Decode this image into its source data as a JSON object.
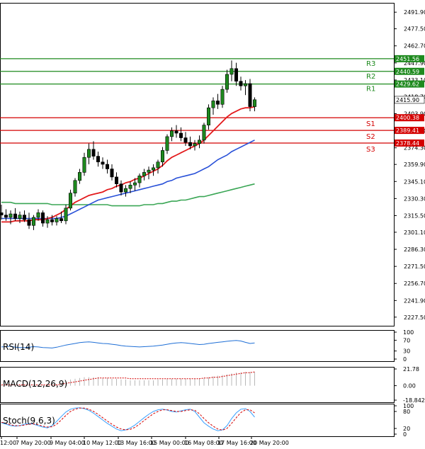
{
  "chart_data": {
    "type": "candlestick",
    "main": {
      "ylim": [
        2220,
        2500
      ],
      "y_ticks": [
        "2491.90",
        "2477.50",
        "2462.70",
        "2447.90",
        "2433.10",
        "2418.70",
        "2403.90",
        "2389.10",
        "2374.30",
        "2359.90",
        "2345.10",
        "2330.30",
        "2315.50",
        "2301.10",
        "2286.30",
        "2271.50",
        "2256.70",
        "2241.90",
        "2227.50"
      ],
      "current_price": "2415.90",
      "levels": [
        {
          "name": "R3",
          "value": 2451.56,
          "label": "2451.56",
          "role": "resistance"
        },
        {
          "name": "R2",
          "value": 2440.59,
          "label": "2440.59",
          "role": "resistance"
        },
        {
          "name": "R1",
          "value": 2429.62,
          "label": "2429.62",
          "role": "resistance"
        },
        {
          "name": "S1",
          "value": 2400.38,
          "label": "2400.38",
          "role": "support"
        },
        {
          "name": "S2",
          "value": 2389.41,
          "label": "2389.41",
          "role": "support"
        },
        {
          "name": "S3",
          "value": 2378.44,
          "label": "2378.44",
          "role": "support"
        }
      ],
      "candles": [
        [
          2318,
          2325,
          2312,
          2316
        ],
        [
          2316,
          2321,
          2311,
          2314
        ],
        [
          2314,
          2320,
          2308,
          2317
        ],
        [
          2317,
          2322,
          2311,
          2313
        ],
        [
          2313,
          2319,
          2309,
          2316
        ],
        [
          2316,
          2320,
          2310,
          2312
        ],
        [
          2312,
          2318,
          2304,
          2307
        ],
        [
          2307,
          2316,
          2303,
          2314
        ],
        [
          2314,
          2321,
          2311,
          2318
        ],
        [
          2318,
          2320,
          2306,
          2309
        ],
        [
          2309,
          2315,
          2305,
          2312
        ],
        [
          2312,
          2316,
          2307,
          2310
        ],
        [
          2310,
          2315,
          2307,
          2313
        ],
        [
          2313,
          2319,
          2309,
          2311
        ],
        [
          2311,
          2325,
          2308,
          2322
        ],
        [
          2322,
          2338,
          2320,
          2335
        ],
        [
          2335,
          2348,
          2332,
          2346
        ],
        [
          2346,
          2356,
          2343,
          2353
        ],
        [
          2353,
          2370,
          2350,
          2366
        ],
        [
          2366,
          2378,
          2360,
          2373
        ],
        [
          2373,
          2380,
          2364,
          2367
        ],
        [
          2367,
          2371,
          2358,
          2362
        ],
        [
          2362,
          2366,
          2356,
          2360
        ],
        [
          2360,
          2364,
          2352,
          2356
        ],
        [
          2356,
          2360,
          2346,
          2349
        ],
        [
          2349,
          2353,
          2340,
          2343
        ],
        [
          2343,
          2346,
          2333,
          2336
        ],
        [
          2336,
          2342,
          2332,
          2339
        ],
        [
          2339,
          2345,
          2335,
          2342
        ],
        [
          2342,
          2348,
          2337,
          2344
        ],
        [
          2344,
          2352,
          2340,
          2350
        ],
        [
          2350,
          2356,
          2346,
          2353
        ],
        [
          2353,
          2358,
          2347,
          2355
        ],
        [
          2355,
          2360,
          2350,
          2357
        ],
        [
          2357,
          2364,
          2352,
          2362
        ],
        [
          2362,
          2375,
          2358,
          2372
        ],
        [
          2372,
          2386,
          2369,
          2384
        ],
        [
          2384,
          2392,
          2380,
          2389
        ],
        [
          2389,
          2394,
          2383,
          2387
        ],
        [
          2387,
          2392,
          2380,
          2383
        ],
        [
          2383,
          2388,
          2376,
          2379
        ],
        [
          2379,
          2384,
          2373,
          2376
        ],
        [
          2376,
          2381,
          2372,
          2378
        ],
        [
          2378,
          2385,
          2374,
          2381
        ],
        [
          2381,
          2396,
          2378,
          2394
        ],
        [
          2394,
          2412,
          2390,
          2409
        ],
        [
          2409,
          2418,
          2403,
          2415
        ],
        [
          2415,
          2421,
          2408,
          2412
        ],
        [
          2412,
          2428,
          2409,
          2425
        ],
        [
          2425,
          2442,
          2422,
          2438
        ],
        [
          2438,
          2450,
          2432,
          2443
        ],
        [
          2443,
          2448,
          2428,
          2432
        ],
        [
          2432,
          2436,
          2424,
          2428
        ],
        [
          2428,
          2433,
          2420,
          2430
        ],
        [
          2430,
          2434,
          2406,
          2410
        ],
        [
          2410,
          2418,
          2406,
          2416
        ]
      ],
      "ma_fast": [
        2310,
        2310,
        2310,
        2311,
        2311,
        2311,
        2311,
        2312,
        2312,
        2312,
        2313,
        2314,
        2316,
        2318,
        2321,
        2324,
        2327,
        2329,
        2331,
        2333,
        2334,
        2335,
        2336,
        2338,
        2339,
        2341,
        2342,
        2344,
        2345,
        2347,
        2348,
        2350,
        2352,
        2354,
        2356,
        2359,
        2363,
        2366,
        2368,
        2370,
        2372,
        2374,
        2376,
        2378,
        2381,
        2385,
        2389,
        2393,
        2397,
        2401,
        2404,
        2406,
        2408,
        2409,
        2409,
        2410
      ],
      "ma_medium": [
        2313,
        2313,
        2313,
        2313,
        2313,
        2313,
        2313,
        2313,
        2313,
        2313,
        2313,
        2313,
        2313,
        2314,
        2315,
        2317,
        2319,
        2321,
        2323,
        2325,
        2327,
        2329,
        2330,
        2331,
        2332,
        2333,
        2334,
        2335,
        2336,
        2337,
        2338,
        2339,
        2340,
        2341,
        2342,
        2343,
        2345,
        2346,
        2348,
        2349,
        2350,
        2351,
        2352,
        2354,
        2356,
        2358,
        2361,
        2364,
        2366,
        2368,
        2371,
        2373,
        2375,
        2377,
        2379,
        2381
      ],
      "ma_slow": [
        2327,
        2327,
        2327,
        2326,
        2326,
        2326,
        2326,
        2326,
        2326,
        2326,
        2326,
        2325,
        2325,
        2325,
        2325,
        2325,
        2325,
        2325,
        2325,
        2325,
        2325,
        2325,
        2325,
        2325,
        2324,
        2324,
        2324,
        2324,
        2324,
        2324,
        2324,
        2325,
        2325,
        2325,
        2326,
        2326,
        2327,
        2328,
        2328,
        2329,
        2329,
        2330,
        2331,
        2332,
        2332,
        2333,
        2334,
        2335,
        2336,
        2337,
        2338,
        2339,
        2340,
        2341,
        2342,
        2343
      ]
    },
    "panels": [
      {
        "name": "RSI(14)",
        "label": "RSI(14)",
        "ticks": [
          "100",
          "70",
          "30",
          "0"
        ],
        "ylim": [
          0,
          100
        ],
        "series": [
          45,
          46,
          48,
          44,
          43,
          42,
          44,
          46,
          45,
          43,
          42,
          41,
          44,
          48,
          52,
          55,
          58,
          61,
          63,
          64,
          62,
          60,
          58,
          57,
          55,
          53,
          50,
          48,
          47,
          46,
          45,
          46,
          47,
          48,
          50,
          52,
          55,
          58,
          60,
          61,
          60,
          58,
          56,
          54,
          55,
          58,
          60,
          62,
          64,
          66,
          68,
          69,
          67,
          62,
          58,
          60
        ]
      },
      {
        "name": "MACD(12,26,9)",
        "label": "MACD(12,26,9)",
        "ticks": [
          "21.78",
          "0.00",
          "-18.842"
        ],
        "ylim": [
          -18.842,
          21.78
        ],
        "histogram": [
          1,
          1,
          1,
          1,
          1,
          1,
          1,
          1,
          1,
          1,
          1,
          1,
          2,
          4,
          6,
          8,
          9,
          10,
          11,
          11,
          11,
          11,
          10,
          10,
          9,
          9,
          8,
          8,
          7,
          7,
          7,
          7,
          7,
          7,
          8,
          8,
          9,
          9,
          9,
          9,
          9,
          9,
          9,
          9,
          10,
          11,
          12,
          13,
          14,
          15,
          16,
          17,
          17,
          18,
          18,
          18
        ],
        "signal": [
          1,
          1,
          1,
          1,
          1,
          1,
          1,
          1,
          1,
          1,
          1,
          1,
          1,
          2,
          3,
          4,
          5,
          6,
          7,
          8,
          9,
          10,
          10,
          10,
          10,
          10,
          10,
          10,
          9,
          9,
          9,
          9,
          9,
          9,
          9,
          9,
          9,
          9,
          9,
          9,
          9,
          9,
          9,
          9,
          10,
          10,
          11,
          11,
          12,
          13,
          14,
          15,
          16,
          17,
          17,
          18
        ]
      },
      {
        "name": "Stoch(9,6,3)",
        "label": "Stoch(9,6,3)",
        "ticks": [
          "100",
          "80",
          "20",
          "0"
        ],
        "ylim": [
          0,
          100
        ],
        "k": [
          40,
          35,
          30,
          28,
          30,
          35,
          38,
          35,
          30,
          25,
          22,
          30,
          45,
          62,
          78,
          88,
          92,
          93,
          90,
          84,
          74,
          62,
          50,
          38,
          28,
          18,
          12,
          15,
          22,
          32,
          45,
          58,
          70,
          80,
          86,
          88,
          85,
          80,
          78,
          82,
          86,
          88,
          80,
          60,
          40,
          28,
          18,
          12,
          15,
          30,
          55,
          75,
          88,
          90,
          80,
          60
        ],
        "d": [
          42,
          38,
          33,
          30,
          30,
          32,
          35,
          36,
          33,
          28,
          25,
          26,
          35,
          50,
          66,
          80,
          88,
          92,
          92,
          88,
          80,
          70,
          58,
          46,
          35,
          25,
          18,
          15,
          17,
          24,
          35,
          48,
          60,
          72,
          80,
          86,
          86,
          83,
          80,
          80,
          83,
          86,
          84,
          72,
          55,
          40,
          28,
          18,
          14,
          20,
          38,
          58,
          76,
          86,
          86,
          75
        ]
      }
    ],
    "x_tick_labels": [
      "12:00",
      "7 May 20:00",
      "9 May 04:00",
      "10 May 12:00",
      "13 May 16:00",
      "15 May 00:00",
      "16 May 08:00",
      "17 May 16:00",
      "20 May 20:00"
    ],
    "colors": {
      "candle_body": "#1e8a1e",
      "ma_fast": "#e31a1c",
      "ma_medium": "#2850d8",
      "ma_slow": "#3aa655",
      "resistance": "#1e8a1e",
      "support": "#d40000",
      "rsi": "#1f6fd6",
      "stoch_k": "#3aa0ff",
      "stoch_d": "#d40000",
      "macd_hist": "#b8b8b8",
      "macd_signal": "#d40000"
    }
  }
}
